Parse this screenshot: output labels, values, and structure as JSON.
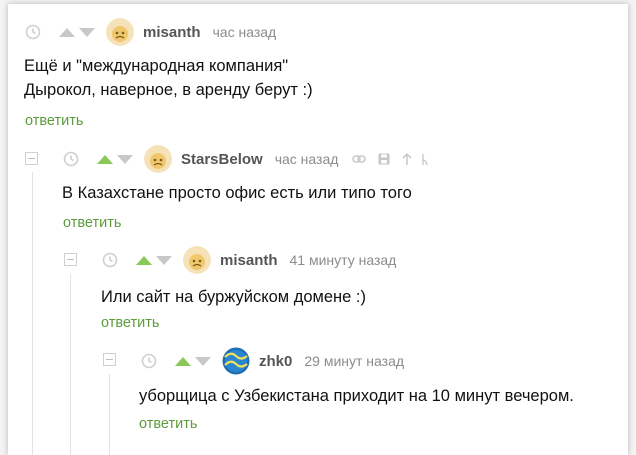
{
  "comments": [
    {
      "nick": "misanth",
      "time": "час назад",
      "lines": [
        "Ещё и \"международная компания\"",
        "Дырокол, наверное, в аренду берут :)"
      ],
      "reply": "ответить"
    },
    {
      "nick": "StarsBelow",
      "time": "час назад",
      "lines": [
        "В Казахстане просто офис есть или типо того"
      ],
      "reply": "ответить",
      "tools": [
        "link-icon",
        "save-icon",
        "pin-icon",
        "more-icon"
      ]
    },
    {
      "nick": "misanth",
      "time": "41 минуту назад",
      "lines": [
        "Или сайт на буржуйском домене :)"
      ],
      "reply": "ответить"
    },
    {
      "nick": "zhk0",
      "time": "29 минут назад",
      "lines": [
        "уборщица с Узбекистана приходит на 10 минут вечером."
      ],
      "reply": "ответить"
    }
  ],
  "colors": {
    "accent_green": "#8ac858",
    "reply_green": "#5d9c3b",
    "muted": "#8b8b8b"
  }
}
